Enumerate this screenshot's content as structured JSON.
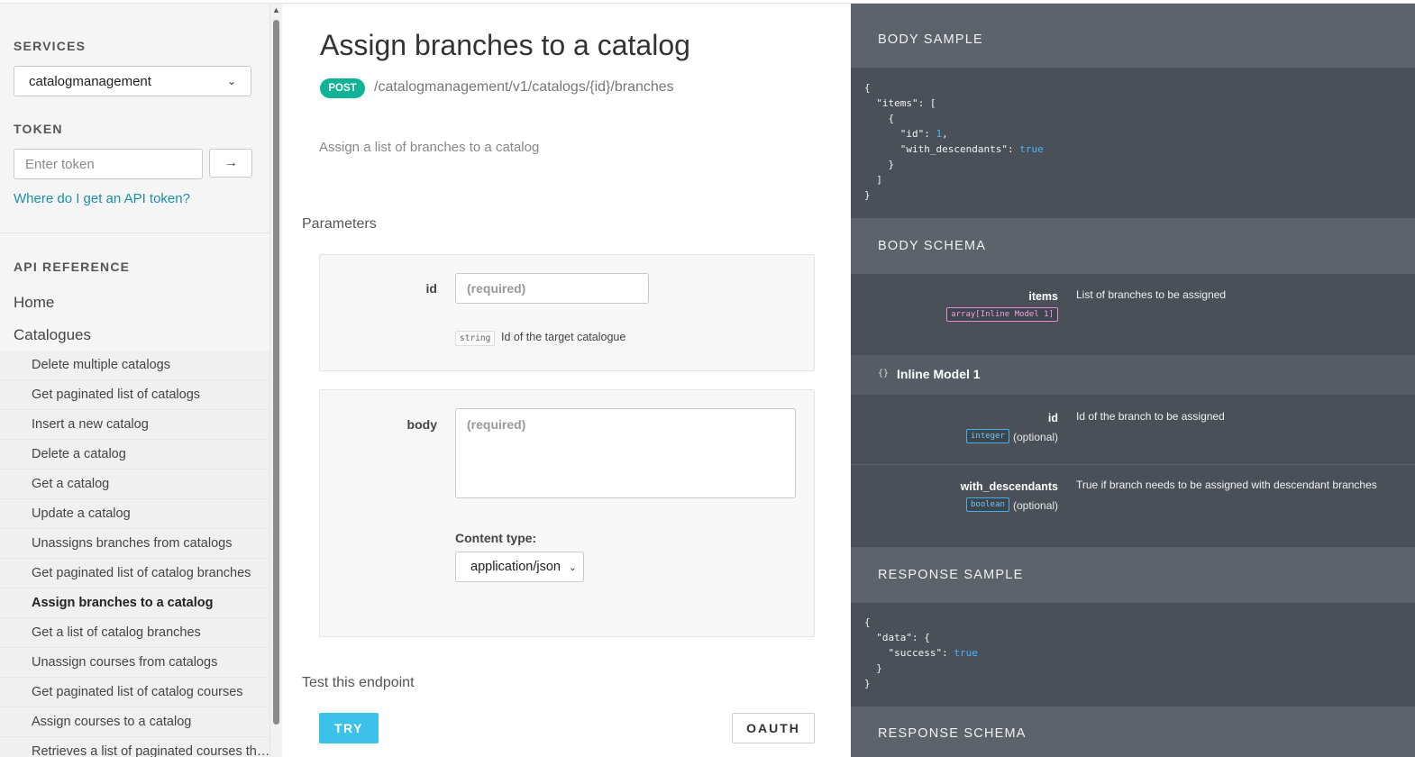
{
  "sidebar": {
    "services_title": "SERVICES",
    "service_selected": "catalogmanagement",
    "token_title": "TOKEN",
    "token_placeholder": "Enter token",
    "token_submit_icon": "→",
    "token_help_link": "Where do I get an API token?",
    "api_ref_title": "API REFERENCE",
    "nav_home": "Home",
    "nav_catalogues": "Catalogues",
    "items": [
      {
        "label": "Delete multiple catalogs",
        "active": false
      },
      {
        "label": "Get paginated list of catalogs",
        "active": false
      },
      {
        "label": "Insert a new catalog",
        "active": false
      },
      {
        "label": "Delete a catalog",
        "active": false
      },
      {
        "label": "Get a catalog",
        "active": false
      },
      {
        "label": "Update a catalog",
        "active": false
      },
      {
        "label": "Unassigns branches from catalogs",
        "active": false
      },
      {
        "label": "Get paginated list of catalog branches",
        "active": false
      },
      {
        "label": "Assign branches to a catalog",
        "active": true
      },
      {
        "label": "Get a list of catalog branches",
        "active": false
      },
      {
        "label": "Unassign courses from catalogs",
        "active": false
      },
      {
        "label": "Get paginated list of catalog courses",
        "active": false
      },
      {
        "label": "Assign courses to a catalog",
        "active": false
      },
      {
        "label": "Retrieves a list of paginated courses th…",
        "active": false
      }
    ]
  },
  "main": {
    "title": "Assign branches to a catalog",
    "method": "POST",
    "path": "/catalogmanagement/v1/catalogs/{id}/branches",
    "description": "Assign a list of branches to a catalog",
    "parameters_heading": "Parameters",
    "param_id": {
      "label": "id",
      "placeholder": "(required)",
      "type": "string",
      "description": "Id of the target catalogue"
    },
    "param_body": {
      "label": "body",
      "placeholder": "(required)",
      "content_type_label": "Content type:",
      "content_type_selected": "application/json"
    },
    "test_heading": "Test this endpoint",
    "try_label": "TRY",
    "oauth_label": "OAUTH"
  },
  "right_panel": {
    "body_sample_title": "BODY SAMPLE",
    "body_schema_title": "BODY SCHEMA",
    "response_sample_title": "RESPONSE SAMPLE",
    "response_schema_title": "RESPONSE SCHEMA",
    "body_sample_code": {
      "l1": "{",
      "l2_key": "\"items\"",
      "l2_rest": ": [",
      "l3": "{",
      "l4_key": "\"id\"",
      "l4_sep": ": ",
      "l4_val": "1",
      "l4_end": ",",
      "l5_key": "\"with_descendants\"",
      "l5_sep": ": ",
      "l5_val": "true",
      "l6": "}",
      "l7": "]",
      "l8": "}"
    },
    "schema_items": {
      "name": "items",
      "type": "array[Inline Model 1]",
      "description": "List of branches to be assigned"
    },
    "inline_model": {
      "icon": "{}",
      "title": "Inline Model 1",
      "fields": [
        {
          "name": "id",
          "type": "integer",
          "optional": "(optional)",
          "description": "Id of the branch to be assigned"
        },
        {
          "name": "with_descendants",
          "type": "boolean",
          "optional": "(optional)",
          "description": "True if branch needs to be assigned with descendant branches"
        }
      ]
    },
    "response_sample_code": {
      "l1": "{",
      "l2_key": "\"data\"",
      "l2_rest": ": {",
      "l3_key": "\"success\"",
      "l3_sep": ": ",
      "l3_val": "true",
      "l4": "}",
      "l5": "}"
    }
  }
}
